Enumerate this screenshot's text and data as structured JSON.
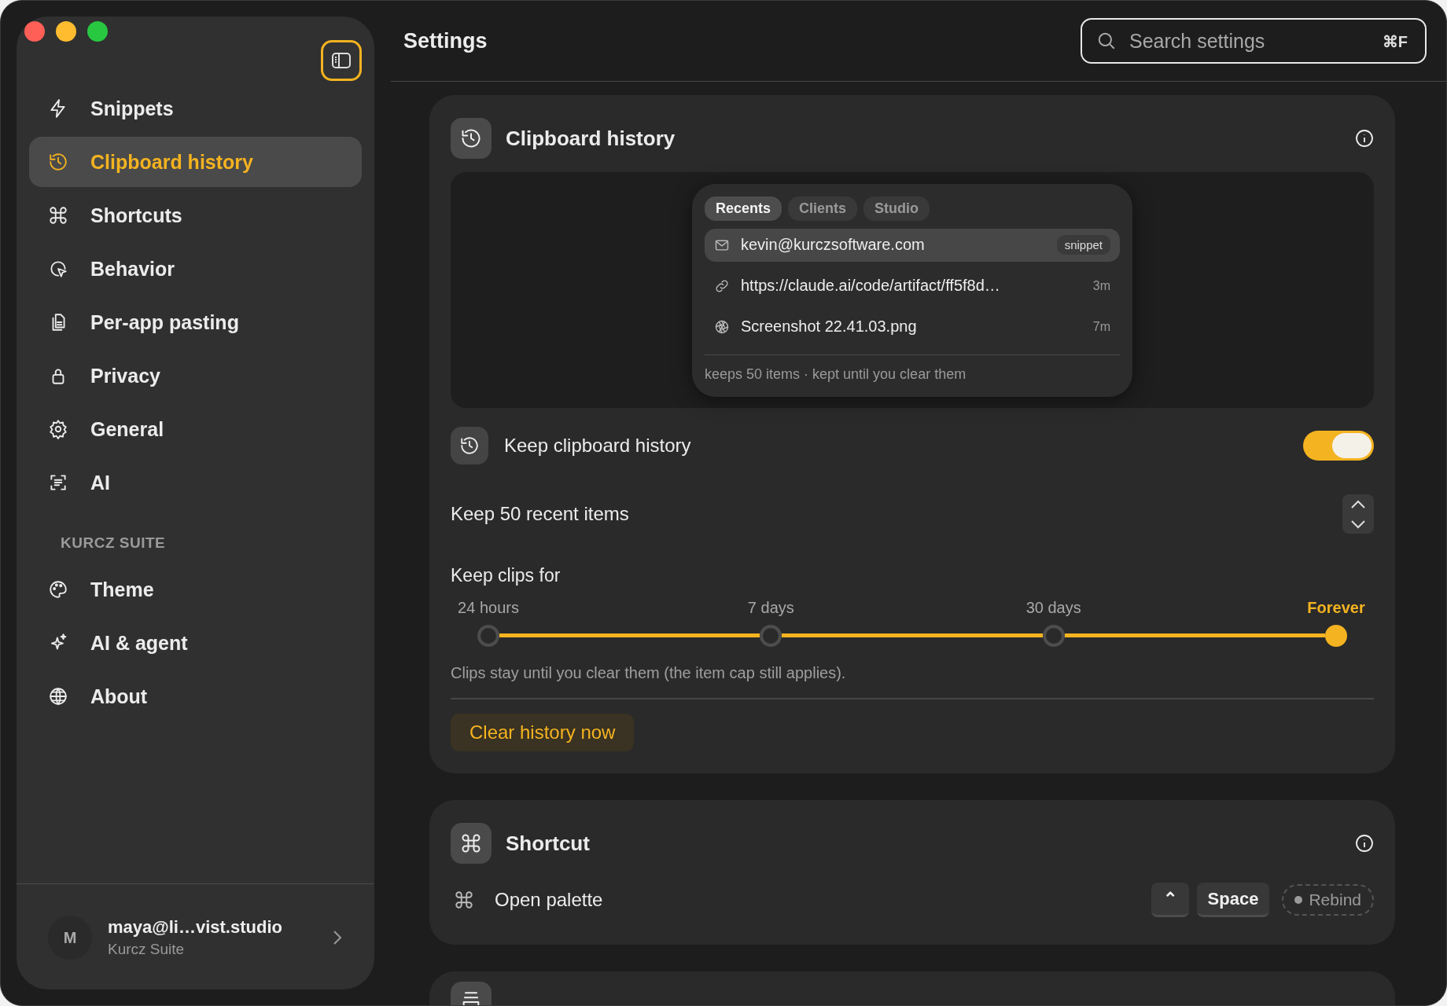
{
  "window": {
    "title": "Settings"
  },
  "sidebar": {
    "items": [
      {
        "label": "Snippets",
        "selected": false
      },
      {
        "label": "Clipboard history",
        "selected": true
      },
      {
        "label": "Shortcuts",
        "selected": false
      },
      {
        "label": "Behavior",
        "selected": false
      },
      {
        "label": "Per-app pasting",
        "selected": false
      },
      {
        "label": "Privacy",
        "selected": false
      },
      {
        "label": "General",
        "selected": false
      },
      {
        "label": "AI",
        "selected": false
      }
    ],
    "section": "KURCZ SUITE",
    "section_items": [
      {
        "label": "Theme",
        "selected": false
      },
      {
        "label": "AI & agent",
        "selected": false
      },
      {
        "label": "About",
        "selected": false
      }
    ],
    "account": {
      "avatar": "M",
      "name": "maya@li…vist.studio",
      "org": "Kurcz Suite"
    }
  },
  "search": {
    "placeholder": "Search settings",
    "shortcut": "⌘F"
  },
  "clipboard_card": {
    "title": "Clipboard history",
    "preview": {
      "tabs": [
        {
          "label": "Recents",
          "selected": true
        },
        {
          "label": "Clients",
          "selected": false
        },
        {
          "label": "Studio",
          "selected": false
        }
      ],
      "items": [
        {
          "kind": "email",
          "text": "kevin@kurczsoftware.com",
          "tag": "snippet",
          "selected": true
        },
        {
          "kind": "link",
          "text": "https://claude.ai/code/artifact/ff5f8d…",
          "time": "3m",
          "selected": false
        },
        {
          "kind": "image",
          "text": "Screenshot 22.41.03.png",
          "time": "7m",
          "selected": false
        }
      ],
      "footer": "keeps 50 items · kept until you clear them"
    },
    "toggle": {
      "label": "Keep clipboard history",
      "on": true
    },
    "stepper": {
      "label": "Keep 50 recent items"
    },
    "retention": {
      "label": "Keep clips for",
      "options": [
        {
          "label": "24 hours",
          "selected": false
        },
        {
          "label": "7 days",
          "selected": false
        },
        {
          "label": "30 days",
          "selected": false
        },
        {
          "label": "Forever",
          "selected": true
        }
      ],
      "note": "Clips stay until you clear them (the item cap still applies)."
    },
    "clear_button": "Clear history now"
  },
  "shortcut_card": {
    "title": "Shortcut",
    "row": {
      "label": "Open palette",
      "keys": [
        "⌃",
        "Space"
      ],
      "rebind": "Rebind"
    }
  }
}
